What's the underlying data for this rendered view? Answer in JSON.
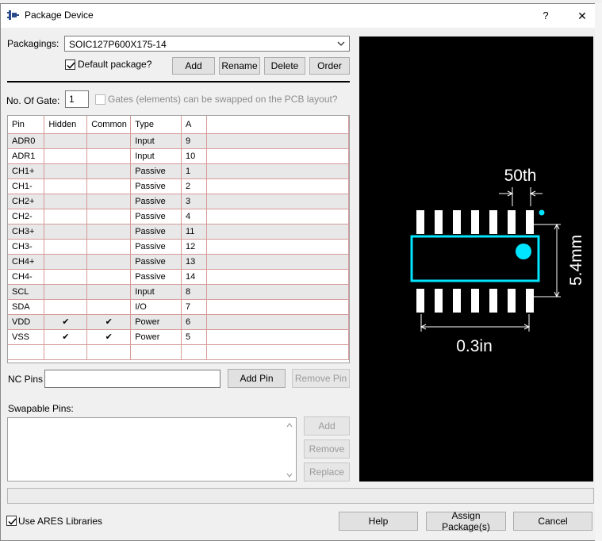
{
  "window": {
    "title": "Package Device",
    "help_glyph": "?",
    "close_glyph": "✕"
  },
  "packagings": {
    "label": "Packagings:",
    "selected": "SOIC127P600X175-14",
    "default_label": "Default package?",
    "default_checked": true,
    "add": "Add",
    "rename": "Rename",
    "delete": "Delete",
    "order": "Order"
  },
  "gates": {
    "label": "No. Of Gate:",
    "value": "1",
    "swap_label": "Gates (elements) can be swapped on the PCB layout?",
    "swap_checked": false
  },
  "pin_table": {
    "columns": [
      "Pin",
      "Hidden",
      "Common",
      "Type",
      "A"
    ],
    "rows": [
      {
        "pin": "ADR0",
        "hidden": "",
        "common": "",
        "type": "Input",
        "a": "9"
      },
      {
        "pin": "ADR1",
        "hidden": "",
        "common": "",
        "type": "Input",
        "a": "10"
      },
      {
        "pin": "CH1+",
        "hidden": "",
        "common": "",
        "type": "Passive",
        "a": "1"
      },
      {
        "pin": "CH1-",
        "hidden": "",
        "common": "",
        "type": "Passive",
        "a": "2"
      },
      {
        "pin": "CH2+",
        "hidden": "",
        "common": "",
        "type": "Passive",
        "a": "3"
      },
      {
        "pin": "CH2-",
        "hidden": "",
        "common": "",
        "type": "Passive",
        "a": "4"
      },
      {
        "pin": "CH3+",
        "hidden": "",
        "common": "",
        "type": "Passive",
        "a": "11"
      },
      {
        "pin": "CH3-",
        "hidden": "",
        "common": "",
        "type": "Passive",
        "a": "12"
      },
      {
        "pin": "CH4+",
        "hidden": "",
        "common": "",
        "type": "Passive",
        "a": "13"
      },
      {
        "pin": "CH4-",
        "hidden": "",
        "common": "",
        "type": "Passive",
        "a": "14"
      },
      {
        "pin": "SCL",
        "hidden": "",
        "common": "",
        "type": "Input",
        "a": "8"
      },
      {
        "pin": "SDA",
        "hidden": "",
        "common": "",
        "type": "I/O",
        "a": "7"
      },
      {
        "pin": "VDD",
        "hidden": "✔",
        "common": "✔",
        "type": "Power",
        "a": "6"
      },
      {
        "pin": "VSS",
        "hidden": "✔",
        "common": "✔",
        "type": "Power",
        "a": "5"
      }
    ]
  },
  "nc_pins": {
    "label": "NC Pins",
    "value": "",
    "add_pin": "Add Pin",
    "remove_pin": "Remove Pin"
  },
  "swapable": {
    "label": "Swapable Pins:",
    "value": "",
    "add": "Add",
    "remove": "Remove",
    "replace": "Replace"
  },
  "footer": {
    "use_ares_label": "Use ARES Libraries",
    "use_ares_checked": true,
    "help": "Help",
    "assign": "Assign Package(s)",
    "cancel": "Cancel"
  },
  "preview": {
    "dim_top": "50th",
    "dim_side": "5.4mm",
    "dim_bottom": "0.3in",
    "colors": {
      "background": "#000000",
      "pads": "#ffffff",
      "outline": "#00e5ff",
      "dims": "#ffffff"
    }
  }
}
